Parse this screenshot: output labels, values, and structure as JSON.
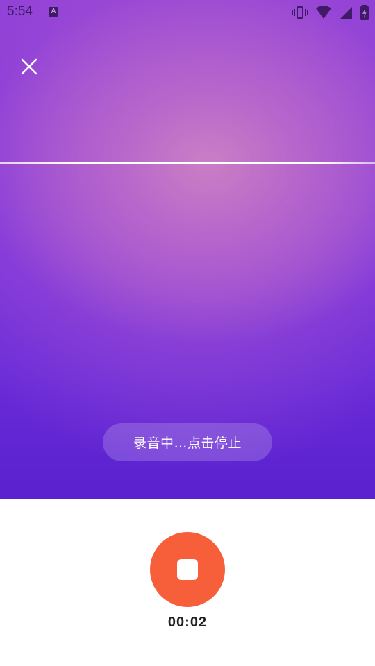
{
  "status_bar": {
    "time": "5:54",
    "notification_icon": "A",
    "icons": [
      "vibrate-icon",
      "wifi-icon",
      "cell-signal-icon",
      "battery-charging-icon"
    ]
  },
  "recorder": {
    "close_icon": "close-icon",
    "hint": "录音中…点击停止",
    "stop_icon": "stop-icon",
    "elapsed": "00:02"
  },
  "colors": {
    "stop_button": "#f65f3a",
    "gradient_top": "#8f3fd6",
    "gradient_bottom": "#5a21cf",
    "glow": "#cc80c4"
  }
}
